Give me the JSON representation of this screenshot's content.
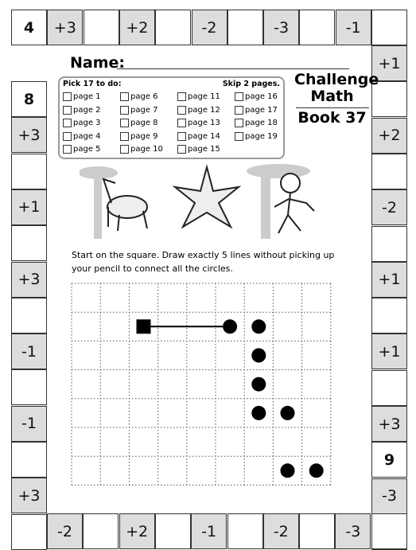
{
  "board": {
    "top": [
      "4",
      "+3",
      "",
      "+2",
      "",
      "-2",
      "",
      "-3",
      "",
      "-1",
      ""
    ],
    "right": [
      "+1",
      "",
      "+2",
      "",
      "-2",
      "",
      "+1",
      "",
      "+1",
      "",
      "+3",
      "9",
      "-3",
      ""
    ],
    "left": [
      "8",
      "+3",
      "",
      "+1",
      "",
      "+3",
      "",
      "-1",
      "",
      "-1",
      "",
      "+3",
      ""
    ],
    "bottom": [
      "-2",
      "",
      "+2",
      "",
      "-1",
      "",
      "-2",
      "",
      "-3",
      ""
    ]
  },
  "header": {
    "name_label": "Name:",
    "title_line1": "Challenge",
    "title_line2": "Math",
    "book": "Book 37"
  },
  "checklist": {
    "left_heading": "Pick 17 to do:",
    "right_heading": "Skip 2 pages.",
    "pages": [
      "page 1",
      "page 2",
      "page 3",
      "page 4",
      "page 5",
      "page 6",
      "page 7",
      "page 8",
      "page 9",
      "page 10",
      "page 11",
      "page 12",
      "page 13",
      "page 14",
      "page 15",
      "page 16",
      "page 17",
      "page 18",
      "page 19"
    ]
  },
  "instructions": "Start on the square.  Draw exactly 5 lines without picking up your pencil to connect all the circles.",
  "puzzle": {
    "columns": 9,
    "rows": 7,
    "start_square": [
      2,
      1
    ],
    "circles": [
      [
        5,
        1
      ],
      [
        6,
        1
      ],
      [
        6,
        2
      ],
      [
        6,
        3
      ],
      [
        6,
        4
      ],
      [
        7,
        4
      ],
      [
        7,
        6
      ],
      [
        8,
        6
      ]
    ],
    "drawn_line": [
      [
        2,
        1
      ],
      [
        5,
        1
      ]
    ]
  }
}
